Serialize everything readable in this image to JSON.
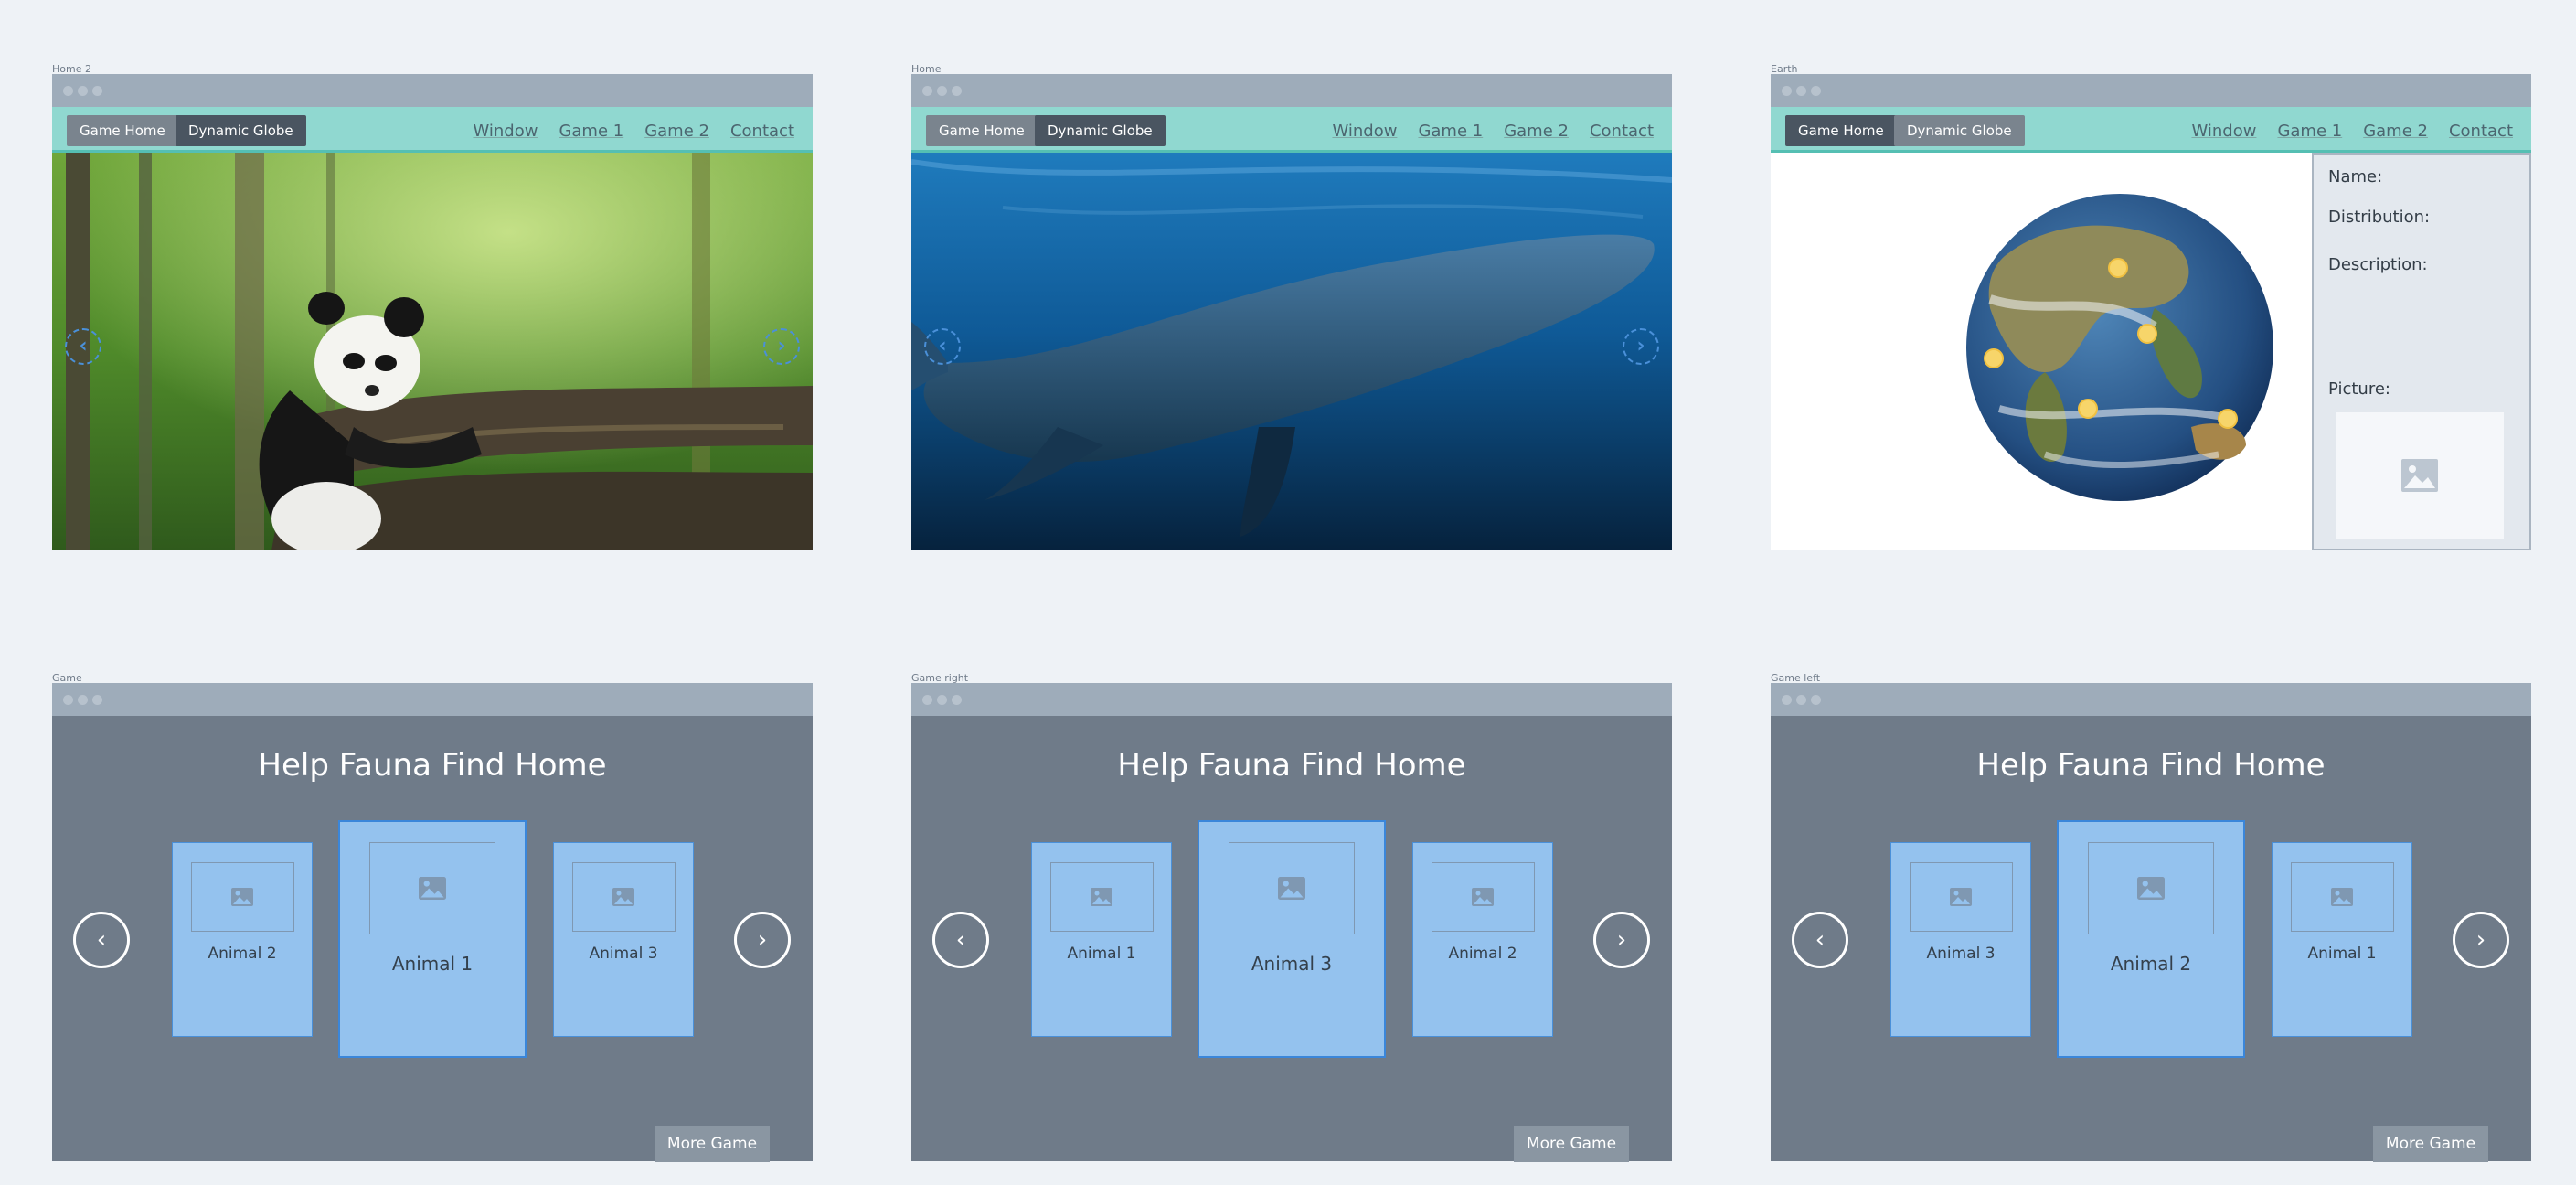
{
  "frames": {
    "home2": {
      "label": "Home 2"
    },
    "home": {
      "label": "Home"
    },
    "earth": {
      "label": "Earth"
    },
    "game": {
      "label": "Game"
    },
    "game_right": {
      "label": "Game right"
    },
    "game_left": {
      "label": "Game left"
    }
  },
  "nav": {
    "game_home": "Game Home",
    "dynamic_globe": "Dynamic Globe",
    "links": [
      "Window",
      "Game 1",
      "Game 2",
      "Contact"
    ]
  },
  "earth_panel": {
    "name_label": "Name:",
    "distribution_label": "Distribution:",
    "description_label": "Description:",
    "picture_label": "Picture:"
  },
  "game": {
    "title": "Help Fauna Find Home",
    "more_button": "More Game",
    "boards": {
      "game": [
        "Animal 2",
        "Animal 1",
        "Animal 3"
      ],
      "game_right": [
        "Animal 1",
        "Animal 3",
        "Animal 2"
      ],
      "game_left": [
        "Animal 3",
        "Animal 2",
        "Animal 1"
      ]
    }
  },
  "colors": {
    "accent_nav": "#90d8d0",
    "card_fill": "#94c2ee",
    "card_border": "#3a86da",
    "game_bg": "#6f7b89"
  },
  "icons": [
    "chevron-left-icon",
    "chevron-right-icon",
    "image-placeholder-icon"
  ]
}
